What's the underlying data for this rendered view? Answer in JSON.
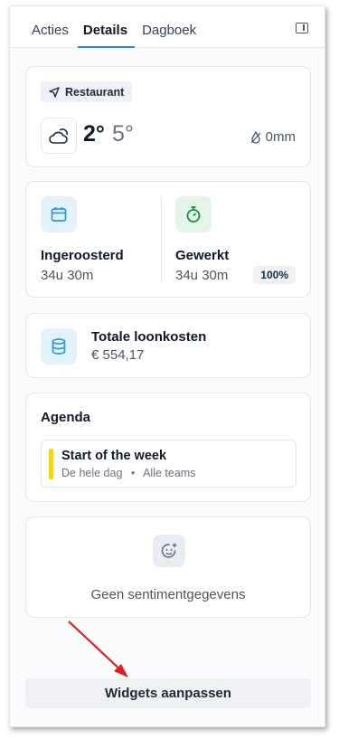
{
  "tabs": [
    {
      "label": "Acties",
      "active": false
    },
    {
      "label": "Details",
      "active": true
    },
    {
      "label": "Dagboek",
      "active": false
    }
  ],
  "weather": {
    "location": "Restaurant",
    "temp_low": "2°",
    "temp_high": "5°",
    "precipitation": "0mm",
    "icon": "cloud-sun-icon"
  },
  "hours": {
    "scheduled": {
      "label": "Ingeroosterd",
      "value": "34u 30m",
      "icon": "calendar-icon"
    },
    "worked": {
      "label": "Gewerkt",
      "value": "34u 30m",
      "percent": "100%",
      "icon": "stopwatch-icon"
    }
  },
  "costs": {
    "label": "Totale loonkosten",
    "value": "€ 554,17",
    "icon": "database-icon"
  },
  "agenda": {
    "title": "Agenda",
    "event": {
      "title": "Start of the week",
      "when": "De hele dag",
      "separator": "•",
      "teams": "Alle teams",
      "color": "#f6d619"
    }
  },
  "sentiment": {
    "empty_text": "Geen sentimentgegevens",
    "icon": "smiley-icon"
  },
  "footer": {
    "customize_label": "Widgets aanpassen"
  },
  "colors": {
    "accent": "#2f80ed",
    "annotation_arrow": "#e02020"
  }
}
